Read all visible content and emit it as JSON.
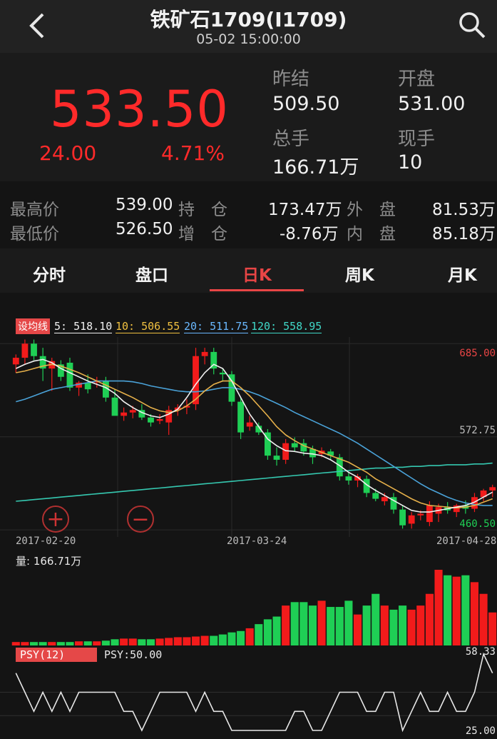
{
  "header": {
    "title": "铁矿石1709(I1709)",
    "time": "05-02 15:00:00"
  },
  "quote": {
    "price": "533.50",
    "change": "24.00",
    "change_pct": "4.71%",
    "fields": [
      {
        "label": "昨结",
        "value": "509.50"
      },
      {
        "label": "开盘",
        "value": "531.00"
      },
      {
        "label": "总手",
        "value": "166.71万"
      },
      {
        "label": "现手",
        "value": "10"
      }
    ]
  },
  "stats": [
    {
      "label": "最高价",
      "value": "539.00"
    },
    {
      "label": "最低价",
      "value": "526.50"
    },
    {
      "label": "持　仓",
      "value": "173.47万"
    },
    {
      "label": "增　仓",
      "value": "-8.76万"
    },
    {
      "label": "外　盘",
      "value": "81.53万"
    },
    {
      "label": "内　盘",
      "value": "85.18万"
    }
  ],
  "tabs": [
    "分时",
    "盘口",
    "日K",
    "周K",
    "月K"
  ],
  "active_tab": "日K",
  "ma": {
    "tag": "设均线",
    "items": [
      {
        "label": "5: 518.10",
        "color": "#f0f0f0"
      },
      {
        "label": "10: 506.55",
        "color": "#f0c040"
      },
      {
        "label": "20: 511.75",
        "color": "#6ab8ff"
      },
      {
        "label": "120: 558.95",
        "color": "#40d8c8"
      }
    ]
  },
  "colors": {
    "up": "#f21b1b",
    "down": "#1fcf55",
    "ma5": "#f0f0f0",
    "ma10": "#e6b04a",
    "ma20": "#4aa2d8",
    "ma120": "#35c8b0"
  },
  "price_axis": [
    "685.00",
    "572.75",
    "460.50"
  ],
  "dates": [
    "2017-02-20",
    "2017-03-24",
    "2017-04-28"
  ],
  "volume_label": "量: 166.71万",
  "psy": {
    "tag": "PSY(12)",
    "value": "PSY:50.00",
    "top": "58.33",
    "bottom": "25.00"
  },
  "zoom_in": "+",
  "zoom_out": "−",
  "chart_data": {
    "type": "candlestick",
    "ylim": [
      460.5,
      685.0
    ],
    "candles": [
      {
        "o": 660,
        "h": 672,
        "l": 650,
        "c": 668
      },
      {
        "o": 668,
        "h": 690,
        "l": 660,
        "c": 685
      },
      {
        "o": 685,
        "h": 690,
        "l": 665,
        "c": 670
      },
      {
        "o": 670,
        "h": 680,
        "l": 640,
        "c": 655
      },
      {
        "o": 655,
        "h": 668,
        "l": 628,
        "c": 664
      },
      {
        "o": 660,
        "h": 665,
        "l": 640,
        "c": 645
      },
      {
        "o": 662,
        "h": 668,
        "l": 628,
        "c": 632
      },
      {
        "o": 632,
        "h": 640,
        "l": 622,
        "c": 638
      },
      {
        "o": 638,
        "h": 648,
        "l": 625,
        "c": 630
      },
      {
        "o": 640,
        "h": 645,
        "l": 632,
        "c": 640
      },
      {
        "o": 640,
        "h": 645,
        "l": 615,
        "c": 620
      },
      {
        "o": 620,
        "h": 630,
        "l": 605,
        "c": 598
      },
      {
        "o": 598,
        "h": 608,
        "l": 592,
        "c": 602
      },
      {
        "o": 602,
        "h": 610,
        "l": 595,
        "c": 605
      },
      {
        "o": 605,
        "h": 612,
        "l": 593,
        "c": 596
      },
      {
        "o": 596,
        "h": 600,
        "l": 585,
        "c": 590
      },
      {
        "o": 592,
        "h": 600,
        "l": 588,
        "c": 594
      },
      {
        "o": 590,
        "h": 610,
        "l": 575,
        "c": 605
      },
      {
        "o": 605,
        "h": 612,
        "l": 598,
        "c": 608
      },
      {
        "o": 608,
        "h": 618,
        "l": 600,
        "c": 610
      },
      {
        "o": 612,
        "h": 680,
        "l": 605,
        "c": 670
      },
      {
        "o": 670,
        "h": 680,
        "l": 660,
        "c": 675
      },
      {
        "o": 675,
        "h": 680,
        "l": 648,
        "c": 655
      },
      {
        "o": 650,
        "h": 655,
        "l": 640,
        "c": 648
      },
      {
        "o": 648,
        "h": 652,
        "l": 610,
        "c": 615
      },
      {
        "o": 615,
        "h": 620,
        "l": 570,
        "c": 578
      },
      {
        "o": 585,
        "h": 598,
        "l": 580,
        "c": 590
      },
      {
        "o": 586,
        "h": 590,
        "l": 575,
        "c": 578
      },
      {
        "o": 578,
        "h": 582,
        "l": 545,
        "c": 550
      },
      {
        "o": 550,
        "h": 560,
        "l": 538,
        "c": 545
      },
      {
        "o": 545,
        "h": 570,
        "l": 540,
        "c": 565
      },
      {
        "o": 565,
        "h": 572,
        "l": 555,
        "c": 560
      },
      {
        "o": 565,
        "h": 570,
        "l": 550,
        "c": 555
      },
      {
        "o": 558,
        "h": 562,
        "l": 540,
        "c": 548
      },
      {
        "o": 552,
        "h": 560,
        "l": 548,
        "c": 556
      },
      {
        "o": 555,
        "h": 558,
        "l": 545,
        "c": 550
      },
      {
        "o": 548,
        "h": 552,
        "l": 520,
        "c": 525
      },
      {
        "o": 525,
        "h": 530,
        "l": 515,
        "c": 520
      },
      {
        "o": 520,
        "h": 528,
        "l": 512,
        "c": 525
      },
      {
        "o": 522,
        "h": 526,
        "l": 500,
        "c": 505
      },
      {
        "o": 505,
        "h": 510,
        "l": 495,
        "c": 498
      },
      {
        "o": 495,
        "h": 505,
        "l": 490,
        "c": 500
      },
      {
        "o": 500,
        "h": 505,
        "l": 480,
        "c": 485
      },
      {
        "o": 485,
        "h": 490,
        "l": 462,
        "c": 466
      },
      {
        "o": 468,
        "h": 482,
        "l": 462,
        "c": 478
      },
      {
        "o": 478,
        "h": 484,
        "l": 472,
        "c": 480
      },
      {
        "o": 470,
        "h": 495,
        "l": 465,
        "c": 490
      },
      {
        "o": 480,
        "h": 492,
        "l": 470,
        "c": 488
      },
      {
        "o": 488,
        "h": 494,
        "l": 480,
        "c": 484
      },
      {
        "o": 482,
        "h": 492,
        "l": 476,
        "c": 490
      },
      {
        "o": 490,
        "h": 496,
        "l": 480,
        "c": 486
      },
      {
        "o": 486,
        "h": 505,
        "l": 482,
        "c": 500
      },
      {
        "o": 500,
        "h": 510,
        "l": 495,
        "c": 508
      },
      {
        "o": 508,
        "h": 515,
        "l": 500,
        "c": 512
      }
    ],
    "ma5": [
      655,
      660,
      664,
      666,
      662,
      655,
      650,
      645,
      640,
      636,
      632,
      625,
      615,
      608,
      602,
      598,
      596,
      600,
      606,
      620,
      636,
      650,
      660,
      655,
      640,
      620,
      600,
      585,
      570,
      562,
      556,
      555,
      553,
      552,
      550,
      545,
      538,
      530,
      524,
      515,
      508,
      502,
      496,
      490,
      484,
      482,
      482,
      484,
      486,
      488,
      490,
      494,
      500,
      506
    ],
    "ma10": [
      650,
      652,
      655,
      658,
      660,
      658,
      654,
      650,
      645,
      640,
      635,
      630,
      625,
      620,
      614,
      608,
      604,
      602,
      604,
      610,
      618,
      628,
      636,
      640,
      640,
      632,
      622,
      610,
      598,
      585,
      575,
      568,
      562,
      558,
      554,
      550,
      546,
      542,
      536,
      530,
      522,
      516,
      510,
      504,
      498,
      493,
      490,
      489,
      488,
      487,
      488,
      490,
      494,
      498
    ],
    "ma20": [
      615,
      618,
      622,
      626,
      630,
      632,
      634,
      636,
      638,
      640,
      640,
      640,
      640,
      639,
      637,
      634,
      632,
      630,
      628,
      627,
      627,
      628,
      630,
      632,
      632,
      630,
      627,
      623,
      618,
      613,
      608,
      602,
      597,
      592,
      587,
      582,
      577,
      571,
      565,
      558,
      551,
      544,
      537,
      530,
      523,
      516,
      510,
      505,
      500,
      496,
      493,
      491,
      490,
      490
    ],
    "ma120": [
      495,
      496,
      497,
      498,
      499,
      500,
      501,
      502,
      503,
      504,
      505,
      506,
      507,
      508,
      509,
      510,
      511,
      512,
      513,
      514,
      515,
      516,
      517,
      518,
      519,
      520,
      521,
      522,
      523,
      524,
      525,
      526,
      527,
      528,
      529,
      530,
      531,
      532,
      533,
      534,
      535,
      535,
      536,
      536,
      537,
      537,
      538,
      538,
      539,
      539,
      539,
      540,
      540,
      541
    ],
    "volume_max": 110,
    "volume": [
      5,
      5,
      5,
      5,
      5,
      5,
      5,
      6,
      6,
      6,
      7,
      9,
      10,
      10,
      9,
      9,
      10,
      11,
      12,
      12,
      13,
      14,
      14,
      16,
      19,
      21,
      25,
      31,
      38,
      42,
      58,
      63,
      63,
      58,
      65,
      56,
      56,
      65,
      45,
      58,
      75,
      58,
      52,
      58,
      52,
      58,
      75,
      110,
      102,
      100,
      102,
      92,
      75,
      48
    ],
    "psy": [
      50,
      41.67,
      33.33,
      41.67,
      33.33,
      41.67,
      33.33,
      41.67,
      41.67,
      41.67,
      41.67,
      41.67,
      33.33,
      33.33,
      25,
      33.33,
      41.67,
      41.67,
      41.67,
      41.67,
      33.33,
      41.67,
      33.33,
      33.33,
      25,
      25,
      25,
      25,
      25,
      25,
      25,
      33.33,
      33.33,
      25,
      25,
      33.33,
      41.67,
      41.67,
      41.67,
      33.33,
      33.33,
      41.67,
      41.67,
      25,
      33.33,
      41.67,
      33.33,
      33.33,
      41.67,
      33.33,
      33.33,
      41.67,
      58.33,
      50
    ]
  }
}
